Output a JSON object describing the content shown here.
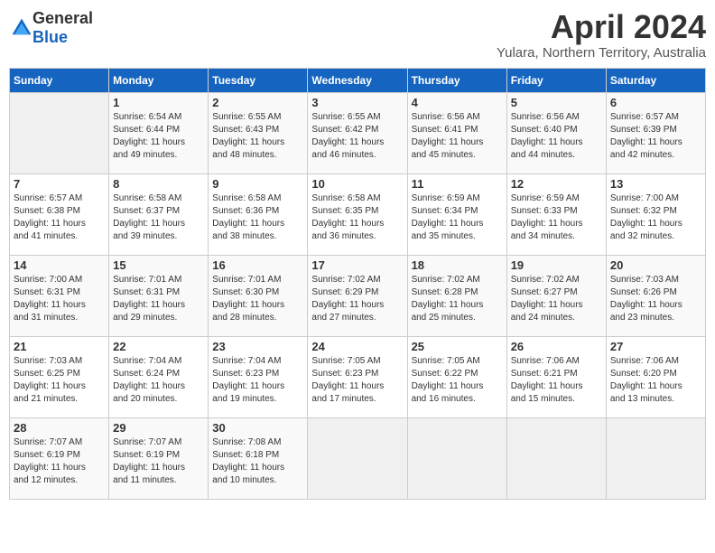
{
  "logo": {
    "general": "General",
    "blue": "Blue"
  },
  "title": "April 2024",
  "location": "Yulara, Northern Territory, Australia",
  "headers": [
    "Sunday",
    "Monday",
    "Tuesday",
    "Wednesday",
    "Thursday",
    "Friday",
    "Saturday"
  ],
  "weeks": [
    [
      {
        "day": "",
        "info": ""
      },
      {
        "day": "1",
        "info": "Sunrise: 6:54 AM\nSunset: 6:44 PM\nDaylight: 11 hours\nand 49 minutes."
      },
      {
        "day": "2",
        "info": "Sunrise: 6:55 AM\nSunset: 6:43 PM\nDaylight: 11 hours\nand 48 minutes."
      },
      {
        "day": "3",
        "info": "Sunrise: 6:55 AM\nSunset: 6:42 PM\nDaylight: 11 hours\nand 46 minutes."
      },
      {
        "day": "4",
        "info": "Sunrise: 6:56 AM\nSunset: 6:41 PM\nDaylight: 11 hours\nand 45 minutes."
      },
      {
        "day": "5",
        "info": "Sunrise: 6:56 AM\nSunset: 6:40 PM\nDaylight: 11 hours\nand 44 minutes."
      },
      {
        "day": "6",
        "info": "Sunrise: 6:57 AM\nSunset: 6:39 PM\nDaylight: 11 hours\nand 42 minutes."
      }
    ],
    [
      {
        "day": "7",
        "info": "Sunrise: 6:57 AM\nSunset: 6:38 PM\nDaylight: 11 hours\nand 41 minutes."
      },
      {
        "day": "8",
        "info": "Sunrise: 6:58 AM\nSunset: 6:37 PM\nDaylight: 11 hours\nand 39 minutes."
      },
      {
        "day": "9",
        "info": "Sunrise: 6:58 AM\nSunset: 6:36 PM\nDaylight: 11 hours\nand 38 minutes."
      },
      {
        "day": "10",
        "info": "Sunrise: 6:58 AM\nSunset: 6:35 PM\nDaylight: 11 hours\nand 36 minutes."
      },
      {
        "day": "11",
        "info": "Sunrise: 6:59 AM\nSunset: 6:34 PM\nDaylight: 11 hours\nand 35 minutes."
      },
      {
        "day": "12",
        "info": "Sunrise: 6:59 AM\nSunset: 6:33 PM\nDaylight: 11 hours\nand 34 minutes."
      },
      {
        "day": "13",
        "info": "Sunrise: 7:00 AM\nSunset: 6:32 PM\nDaylight: 11 hours\nand 32 minutes."
      }
    ],
    [
      {
        "day": "14",
        "info": "Sunrise: 7:00 AM\nSunset: 6:31 PM\nDaylight: 11 hours\nand 31 minutes."
      },
      {
        "day": "15",
        "info": "Sunrise: 7:01 AM\nSunset: 6:31 PM\nDaylight: 11 hours\nand 29 minutes."
      },
      {
        "day": "16",
        "info": "Sunrise: 7:01 AM\nSunset: 6:30 PM\nDaylight: 11 hours\nand 28 minutes."
      },
      {
        "day": "17",
        "info": "Sunrise: 7:02 AM\nSunset: 6:29 PM\nDaylight: 11 hours\nand 27 minutes."
      },
      {
        "day": "18",
        "info": "Sunrise: 7:02 AM\nSunset: 6:28 PM\nDaylight: 11 hours\nand 25 minutes."
      },
      {
        "day": "19",
        "info": "Sunrise: 7:02 AM\nSunset: 6:27 PM\nDaylight: 11 hours\nand 24 minutes."
      },
      {
        "day": "20",
        "info": "Sunrise: 7:03 AM\nSunset: 6:26 PM\nDaylight: 11 hours\nand 23 minutes."
      }
    ],
    [
      {
        "day": "21",
        "info": "Sunrise: 7:03 AM\nSunset: 6:25 PM\nDaylight: 11 hours\nand 21 minutes."
      },
      {
        "day": "22",
        "info": "Sunrise: 7:04 AM\nSunset: 6:24 PM\nDaylight: 11 hours\nand 20 minutes."
      },
      {
        "day": "23",
        "info": "Sunrise: 7:04 AM\nSunset: 6:23 PM\nDaylight: 11 hours\nand 19 minutes."
      },
      {
        "day": "24",
        "info": "Sunrise: 7:05 AM\nSunset: 6:23 PM\nDaylight: 11 hours\nand 17 minutes."
      },
      {
        "day": "25",
        "info": "Sunrise: 7:05 AM\nSunset: 6:22 PM\nDaylight: 11 hours\nand 16 minutes."
      },
      {
        "day": "26",
        "info": "Sunrise: 7:06 AM\nSunset: 6:21 PM\nDaylight: 11 hours\nand 15 minutes."
      },
      {
        "day": "27",
        "info": "Sunrise: 7:06 AM\nSunset: 6:20 PM\nDaylight: 11 hours\nand 13 minutes."
      }
    ],
    [
      {
        "day": "28",
        "info": "Sunrise: 7:07 AM\nSunset: 6:19 PM\nDaylight: 11 hours\nand 12 minutes."
      },
      {
        "day": "29",
        "info": "Sunrise: 7:07 AM\nSunset: 6:19 PM\nDaylight: 11 hours\nand 11 minutes."
      },
      {
        "day": "30",
        "info": "Sunrise: 7:08 AM\nSunset: 6:18 PM\nDaylight: 11 hours\nand 10 minutes."
      },
      {
        "day": "",
        "info": ""
      },
      {
        "day": "",
        "info": ""
      },
      {
        "day": "",
        "info": ""
      },
      {
        "day": "",
        "info": ""
      }
    ]
  ]
}
